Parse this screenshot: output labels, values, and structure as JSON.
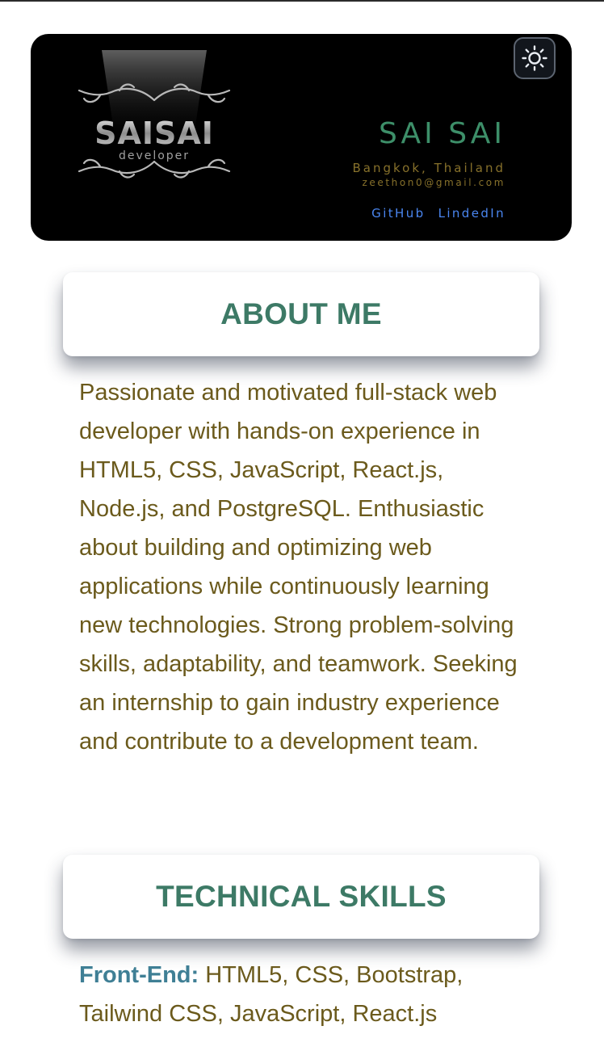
{
  "header": {
    "logo": {
      "title": "SAISAI",
      "subtitle": "developer"
    },
    "theme_toggle_icon": "sun-icon",
    "name": "SAI SAI",
    "location": "Bangkok, Thailand",
    "email": "zeethon0@gmail.com",
    "links": {
      "github": "GitHub",
      "linkedin": "LindedIn"
    }
  },
  "about": {
    "title": "ABOUT ME",
    "body": "Passionate and motivated full-stack web developer with hands-on experience in HTML5, CSS, JavaScript, React.js, Node.js, and PostgreSQL. Enthusiastic about building and optimizing web applications while continuously learning new technologies. Strong problem-solving skills, adaptability, and teamwork. Seeking an internship to gain industry experience and contribute to a development team."
  },
  "skills": {
    "title": "TECHNICAL SKILLS",
    "frontend_label": "Front-End:",
    "frontend_value": " HTML5, CSS, Bootstrap, Tailwind CSS, JavaScript, React.js"
  },
  "colors": {
    "name": "#3d8f69",
    "location": "#87712b",
    "link": "#4a86f0",
    "section_title": "#3d7a66",
    "body_text": "#6b5a1c",
    "skill_label": "#3f7f95"
  }
}
